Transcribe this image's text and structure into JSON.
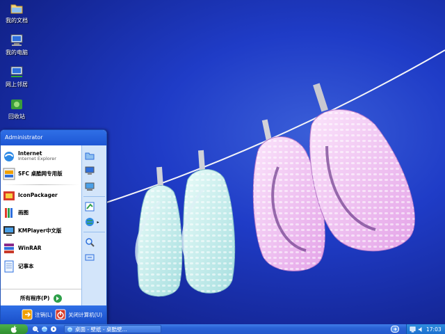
{
  "desktop": {
    "icons": [
      {
        "label": "我的文档",
        "icon": "my-documents-icon"
      },
      {
        "label": "我的电脑",
        "icon": "my-computer-icon"
      },
      {
        "label": "网上邻居",
        "icon": "network-places-icon"
      },
      {
        "label": "回收站",
        "icon": "recycle-bin-icon"
      }
    ]
  },
  "start_menu": {
    "user": "Administrator",
    "pinned": [
      {
        "label": "Internet",
        "sub": "Internet Explorer",
        "icon": "internet-explorer-icon"
      },
      {
        "label": "SFC 桌酷网专用版",
        "icon": "sfc-icon"
      }
    ],
    "recent": [
      {
        "label": "IconPackager",
        "icon": "iconpackager-icon"
      },
      {
        "label": "画图",
        "icon": "paint-icon"
      },
      {
        "label": "KMPlayer中文版",
        "icon": "kmplayer-icon"
      },
      {
        "label": "WinRAR",
        "icon": "winrar-icon"
      },
      {
        "label": "记事本",
        "icon": "notepad-icon"
      }
    ],
    "all_programs": "所有程序(P)",
    "right_icons": [
      "folder-icon",
      "computer-icon",
      "monitor-icon",
      "control-panel-icon",
      "network-globe-icon",
      "search-icon",
      "run-icon"
    ],
    "logoff": "注销(L)",
    "shutdown": "关闭计算机(U)"
  },
  "taskbar": {
    "task_label": "桌面 - 壁纸 - 桌酷壁...",
    "clock": "17:03"
  },
  "colors": {
    "start_green": "#3a9d3a",
    "taskbar_blue": "#2a62d6",
    "menu_blue": "#2f6fe6"
  }
}
